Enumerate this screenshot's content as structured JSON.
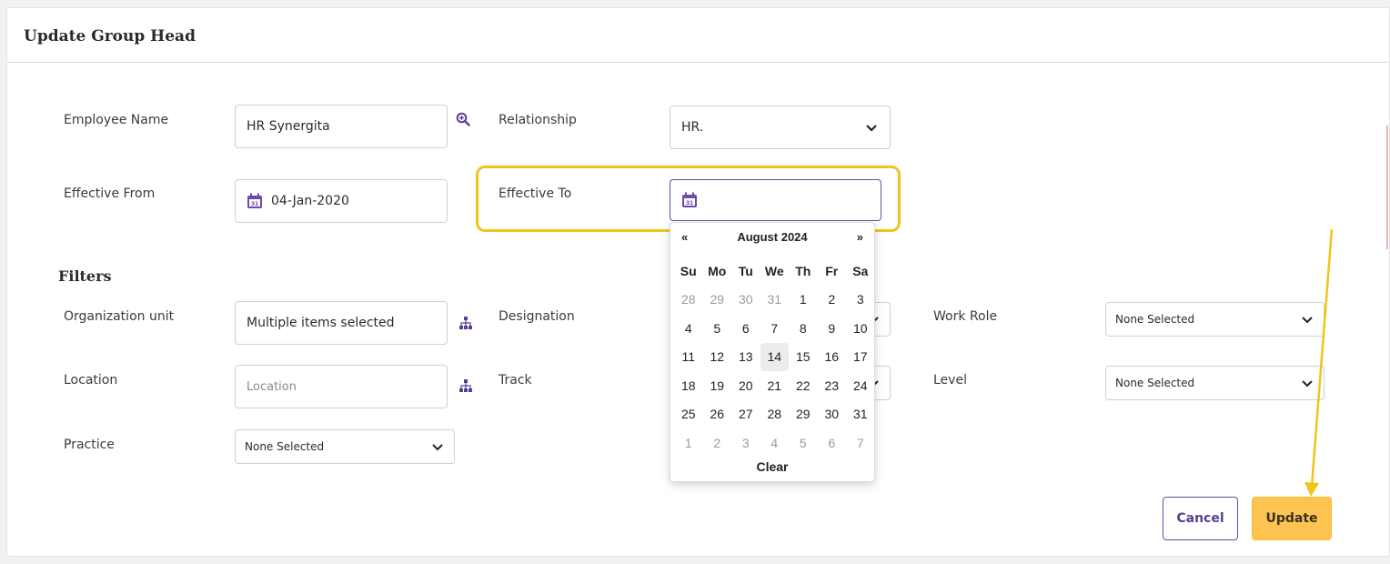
{
  "card": {
    "title": "Update Group Head"
  },
  "form": {
    "employee_name": {
      "label": "Employee Name",
      "value": "HR Synergita",
      "icon": "zoom-icon"
    },
    "relationship": {
      "label": "Relationship",
      "value": "HR."
    },
    "effective_from": {
      "label": "Effective From",
      "value": "04-Jan-2020"
    },
    "effective_to": {
      "label": "Effective To",
      "value": ""
    }
  },
  "filters": {
    "title": "Filters",
    "organization_unit": {
      "label": "Organization unit",
      "value": "Multiple items selected"
    },
    "designation": {
      "label": "Designation"
    },
    "work_role": {
      "label": "Work Role",
      "value": "None Selected"
    },
    "location": {
      "label": "Location",
      "placeholder": "Location"
    },
    "track": {
      "label": "Track"
    },
    "level": {
      "label": "Level",
      "value": "None Selected"
    },
    "practice": {
      "label": "Practice",
      "value": "None Selected"
    }
  },
  "datepicker": {
    "prev": "«",
    "next": "»",
    "month_label": "August 2024",
    "weekdays": [
      "Su",
      "Mo",
      "Tu",
      "We",
      "Th",
      "Fr",
      "Sa"
    ],
    "weeks": [
      [
        "28",
        "29",
        "30",
        "31",
        "1",
        "2",
        "3"
      ],
      [
        "4",
        "5",
        "6",
        "7",
        "8",
        "9",
        "10"
      ],
      [
        "11",
        "12",
        "13",
        "14",
        "15",
        "16",
        "17"
      ],
      [
        "18",
        "19",
        "20",
        "21",
        "22",
        "23",
        "24"
      ],
      [
        "25",
        "26",
        "27",
        "28",
        "29",
        "30",
        "31"
      ],
      [
        "1",
        "2",
        "3",
        "4",
        "5",
        "6",
        "7"
      ]
    ],
    "today": "14",
    "clear_label": "Clear"
  },
  "actions": {
    "cancel": "Cancel",
    "update": "Update"
  },
  "colors": {
    "accent": "#6b4aa8",
    "highlight": "#f2c418",
    "update_button": "#fdc451"
  }
}
